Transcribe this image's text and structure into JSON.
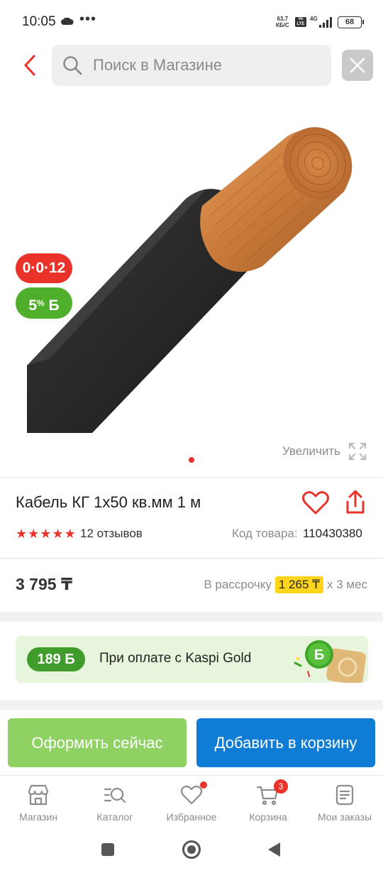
{
  "status_bar": {
    "time": "10:05",
    "net_speed": "63,7",
    "net_unit": "КБ/С",
    "volte": "Vo LTE",
    "network": "4G",
    "battery": "68"
  },
  "search": {
    "placeholder": "Поиск в Магазине"
  },
  "product": {
    "badge_installment": "0·0·12",
    "badge_bonus_value": "5",
    "badge_bonus_suffix": "%",
    "badge_bonus_currency": "Б",
    "zoom_label": "Увеличить",
    "image_count": 1,
    "active_image": 1,
    "title": "Кабель КГ 1х50 кв.мм 1 м",
    "rating": 5,
    "reviews_label": "12 отзывов",
    "sku_label": "Код товара:",
    "sku_value": "110430380",
    "price": "3 795 ₸",
    "installment_prefix": "В рассрочку",
    "installment_amount": "1 265 ₸",
    "installment_suffix": "х 3 мес"
  },
  "kaspi_gold": {
    "bonus_chip": "189 Б",
    "text": "При оплате с Kaspi Gold",
    "art_letter": "Б"
  },
  "actions": {
    "buy_now_label": "Оформить сейчас",
    "add_to_cart_label": "Добавить в корзину"
  },
  "bottom_nav": {
    "items": [
      {
        "label": "Магазин",
        "icon": "shop-icon"
      },
      {
        "label": "Каталог",
        "icon": "catalog-icon"
      },
      {
        "label": "Избранное",
        "icon": "heart-icon"
      },
      {
        "label": "Корзина",
        "icon": "cart-icon",
        "badge": "3"
      },
      {
        "label": "Мои заказы",
        "icon": "orders-icon"
      }
    ]
  },
  "colors": {
    "accent_red": "#e9322a",
    "kaspi_green": "#4fae2a",
    "buy_now_green": "#8fd163",
    "cart_blue": "#0f7cd6",
    "installment_yellow": "#ffd51c"
  }
}
